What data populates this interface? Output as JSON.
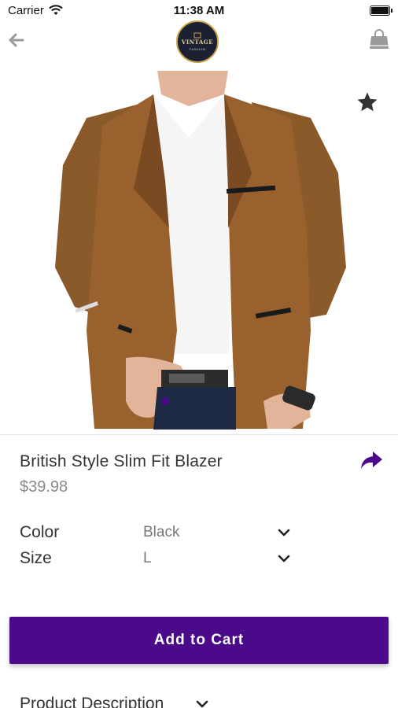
{
  "status_bar": {
    "carrier": "Carrier",
    "time": "11:38 AM"
  },
  "header": {
    "logo_title": "VINTAGE",
    "logo_subtitle": "FASHION",
    "icons": {
      "back": "arrow-left-icon",
      "bag": "shopping-bag-icon"
    }
  },
  "product": {
    "name": "British Style Slim Fit Blazer",
    "price": "$39.98",
    "image_subject": "brown corduroy blazer over white t-shirt"
  },
  "options": [
    {
      "label": "Color",
      "value": "Black"
    },
    {
      "label": "Size",
      "value": "L"
    }
  ],
  "actions": {
    "add_to_cart": "Add to Cart"
  },
  "description": {
    "label": "Product Description"
  },
  "colors": {
    "accent": "#4a0a8a",
    "icon_gray": "#9a9a9a",
    "text": "#333333",
    "price": "#8a8a8a"
  }
}
